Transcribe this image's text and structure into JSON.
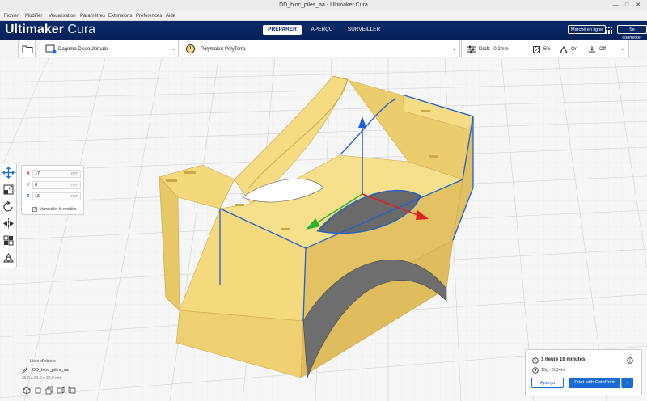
{
  "window": {
    "title": "DD_bloc_piles_aa - Ultimaker Cura"
  },
  "menu": [
    "Fichier",
    "Modifier",
    "Visualisation",
    "Paramètres",
    "Extensions",
    "Préférences",
    "Aide"
  ],
  "brand": {
    "strong": "Ultimaker",
    "light": " Cura"
  },
  "stages": {
    "prepare": "PRÉPARER",
    "preview": "APERÇU",
    "monitor": "SURVEILLER"
  },
  "header_buttons": {
    "marketplace": "Marché en ligne",
    "signin": "Se connecter"
  },
  "toolbar": {
    "printer": "Dagoma DiscoUltimate",
    "material_number": "1",
    "material": "Polymaker PolyTerra",
    "profile": "Draft - 0.2mm",
    "infill": "5%",
    "support": "On",
    "adhesion": "Off"
  },
  "move_panel": {
    "x_label": "X",
    "x_value": "17",
    "y_label": "Y",
    "y_value": "0",
    "z_label": "Z",
    "z_value": "16",
    "unit": "mm",
    "lock_check": "✓",
    "lock_label": "Verrouiller le modèle"
  },
  "object_list": {
    "header": "Liste d'objets",
    "name": "DD_bloc_piles_aa",
    "dimensions": "36.0 x 61.0 x 32.0 mm"
  },
  "print_panel": {
    "time": "1 heure 19 minutes",
    "material": "15g · 5.14m",
    "preview_button": "Aperçu",
    "print_button": "Print with OctoPrint"
  },
  "colors": {
    "accent": "#1a6ad6",
    "header": "#0a2a6a",
    "model": "#f5d97a"
  }
}
